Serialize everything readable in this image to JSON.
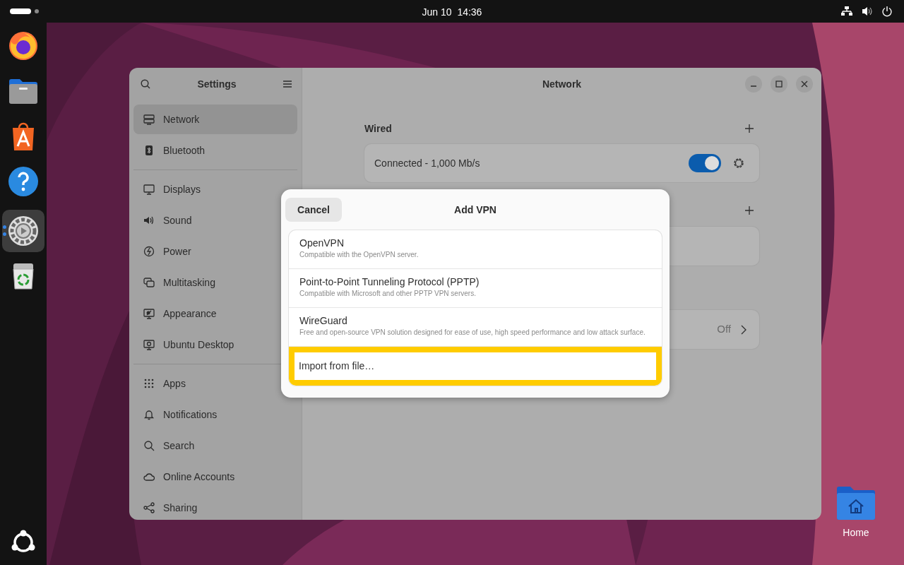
{
  "top_bar": {
    "date": "Jun 10",
    "time": "14:36"
  },
  "dock": {
    "items": [
      {
        "kind": "browser",
        "selected": false,
        "running": false
      },
      {
        "kind": "files",
        "selected": false,
        "running": false
      },
      {
        "kind": "store",
        "selected": false,
        "running": false
      },
      {
        "kind": "help",
        "selected": false,
        "running": false
      },
      {
        "kind": "settings",
        "selected": true,
        "running": true
      },
      {
        "kind": "trash",
        "selected": false,
        "running": false
      }
    ]
  },
  "settings_window": {
    "sidebar": {
      "title": "Settings",
      "groups": [
        [
          {
            "label": "Network",
            "selected": true
          },
          {
            "label": "Bluetooth",
            "selected": false
          }
        ],
        [
          {
            "label": "Displays",
            "selected": false
          },
          {
            "label": "Sound",
            "selected": false
          },
          {
            "label": "Power",
            "selected": false
          },
          {
            "label": "Multitasking",
            "selected": false
          },
          {
            "label": "Appearance",
            "selected": false
          },
          {
            "label": "Ubuntu Desktop",
            "selected": false
          }
        ],
        [
          {
            "label": "Apps",
            "selected": false
          },
          {
            "label": "Notifications",
            "selected": false
          },
          {
            "label": "Search",
            "selected": false
          },
          {
            "label": "Online Accounts",
            "selected": false
          },
          {
            "label": "Sharing",
            "selected": false
          }
        ]
      ]
    },
    "title": "Network",
    "wired": {
      "title": "Wired",
      "connection": {
        "label": "Connected - 1,000 Mb/s",
        "on": true
      }
    },
    "proxy": {
      "value": "Off"
    }
  },
  "dialog": {
    "cancel": "Cancel",
    "title": "Add VPN",
    "options": [
      {
        "title": "OpenVPN",
        "description": "Compatible with the OpenVPN server."
      },
      {
        "title": "Point-to-Point Tunneling Protocol (PPTP)",
        "description": "Compatible with Microsoft and other PPTP VPN servers."
      },
      {
        "title": "WireGuard",
        "description": "Free and open-source VPN solution designed for ease of use, high speed performance and low attack surface."
      }
    ],
    "import": {
      "label": "Import from file…",
      "highlighted": true
    }
  },
  "desktop": {
    "home_label": "Home"
  }
}
